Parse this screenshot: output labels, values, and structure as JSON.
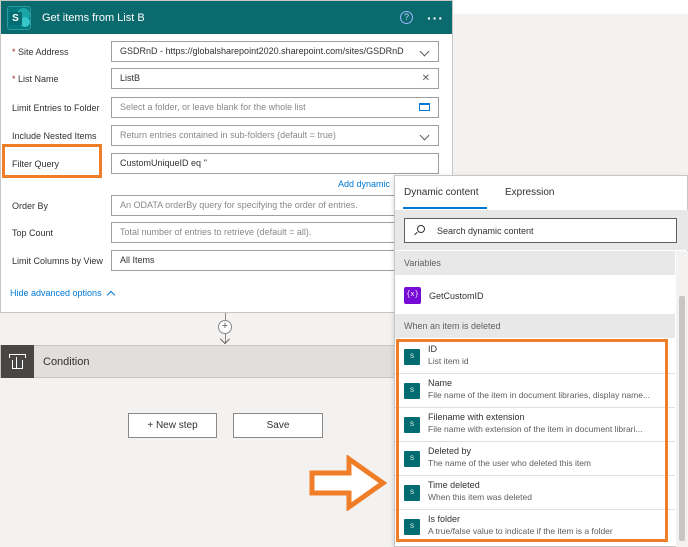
{
  "card": {
    "title": "Get items from List B",
    "logo_letter": "S",
    "help_label": "?",
    "more_label": "···",
    "fields": [
      {
        "label": "Site Address",
        "required": true,
        "value": "GSDRnD - https://globalsharepoint2020.sharepoint.com/sites/GSDRnD",
        "placeholder": false,
        "icon": "chevron-down-icon"
      },
      {
        "label": "List Name",
        "required": true,
        "value": "ListB",
        "placeholder": false,
        "icon": "clear-icon"
      },
      {
        "label": "Limit Entries to Folder",
        "required": false,
        "value": "Select a folder, or leave blank for the whole list",
        "placeholder": true,
        "icon": "folder-icon"
      },
      {
        "label": "Include Nested Items",
        "required": false,
        "value": "Return entries contained in sub-folders (default = true)",
        "placeholder": true,
        "icon": "chevron-down-icon"
      },
      {
        "label": "Filter Query",
        "required": false,
        "value": "CustomUniqueID eq ''",
        "placeholder": false,
        "icon": ""
      },
      {
        "label": "Order By",
        "required": false,
        "value": "An ODATA orderBy query for specifying the order of entries.",
        "placeholder": true,
        "icon": ""
      },
      {
        "label": "Top Count",
        "required": false,
        "value": "Total number of entries to retrieve (default = all).",
        "placeholder": true,
        "icon": ""
      },
      {
        "label": "Limit Columns by View",
        "required": false,
        "value": "All Items",
        "placeholder": false,
        "icon": ""
      }
    ],
    "add_dynamic_label": "Add dynamic",
    "hide_advanced_label": "Hide advanced options"
  },
  "condition": {
    "title": "Condition"
  },
  "buttons": {
    "new_step": "+ New step",
    "save": "Save"
  },
  "panel": {
    "tabs": [
      "Dynamic content",
      "Expression"
    ],
    "search_placeholder": "Search dynamic content",
    "sections": {
      "variables": "Variables",
      "deleted": "When an item is deleted"
    },
    "variables": [
      {
        "name": "GetCustomID",
        "icon_text": "{x}"
      }
    ],
    "items": [
      {
        "name": "ID",
        "desc": "List item id"
      },
      {
        "name": "Name",
        "desc": "File name of the item in document libraries, display name..."
      },
      {
        "name": "Filename with extension",
        "desc": "File name with extension of the item in document librari..."
      },
      {
        "name": "Deleted by",
        "desc": "The name of the user who deleted this item"
      },
      {
        "name": "Time deleted",
        "desc": "When this item was deleted"
      },
      {
        "name": "Is folder",
        "desc": "A true/false value to indicate if the item is a folder"
      }
    ],
    "item_icon_text": "S"
  },
  "colors": {
    "header": "#0b6a6e",
    "highlight": "#f07e28",
    "link": "#0078d4",
    "variable": "#770bd6"
  }
}
